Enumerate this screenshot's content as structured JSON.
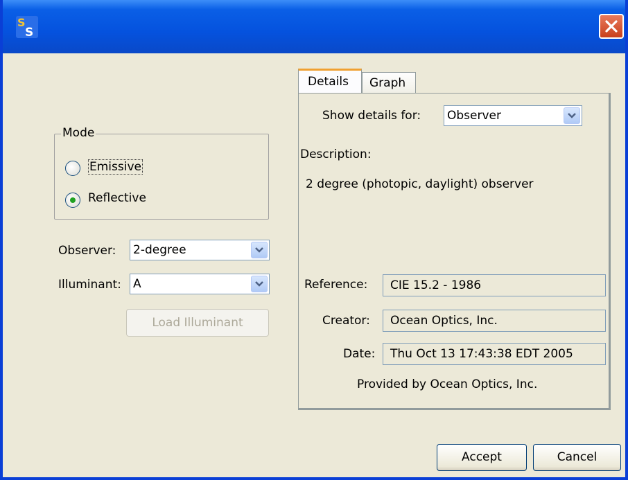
{
  "titlebar": {
    "icon_name": "ss-app-icon",
    "close_icon": "close-icon"
  },
  "mode": {
    "legend": "Mode",
    "options": [
      {
        "label": "Emissive",
        "selected": false
      },
      {
        "label": "Reflective",
        "selected": true
      }
    ]
  },
  "observer": {
    "label": "Observer:",
    "value": "2-degree"
  },
  "illuminant": {
    "label": "Illuminant:",
    "value": "A"
  },
  "load_button": "Load Illuminant",
  "tabs": [
    {
      "label": "Details",
      "active": true
    },
    {
      "label": "Graph",
      "active": false
    }
  ],
  "details": {
    "show_label": "Show details for:",
    "show_value": "Observer",
    "description_label": "Description:",
    "description": "2 degree (photopic, daylight) observer",
    "reference_label": "Reference:",
    "reference": "CIE 15.2 - 1986",
    "creator_label": "Creator:",
    "creator": "Ocean Optics, Inc.",
    "date_label": "Date:",
    "date": "Thu Oct 13 17:43:38 EDT 2005",
    "provided_by": "Provided by Ocean Optics, Inc."
  },
  "buttons": {
    "accept": "Accept",
    "cancel": "Cancel"
  },
  "colors": {
    "titlebar": "#0552de",
    "window_bg": "#ece9d8",
    "tab_highlight": "#f0a030",
    "radio_dot": "#21a121"
  }
}
